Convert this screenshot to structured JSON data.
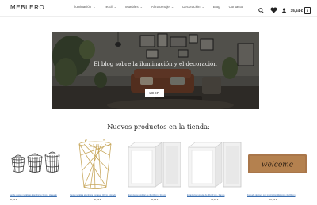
{
  "header": {
    "logo": "MEBLERO",
    "nav": [
      {
        "label": "Iluminación",
        "has_dropdown": true
      },
      {
        "label": "Textil",
        "has_dropdown": true
      },
      {
        "label": "Muebles",
        "has_dropdown": true
      },
      {
        "label": "Almacenaje",
        "has_dropdown": true
      },
      {
        "label": "Decoración",
        "has_dropdown": true
      },
      {
        "label": "Blog",
        "has_dropdown": false
      },
      {
        "label": "Contacto",
        "has_dropdown": false
      }
    ],
    "icons": [
      "search-icon",
      "heart-icon",
      "user-icon"
    ],
    "cart_total": "35,54 €",
    "cart_count": "3"
  },
  "hero": {
    "title": "El blog sobre la iluminación y el decoración",
    "button_label": "LEER"
  },
  "products_section": {
    "title": "Nuevos productos en la tienda:",
    "items": [
      {
        "name": "Set de cestas metálicas alámbricas 3 pcs - plateado",
        "price": "42,99 €",
        "image": "wire-baskets"
      },
      {
        "name": "Cesta metálica alámbrica con asas 40 cm - dorado",
        "price": "38,99 €",
        "image": "gold-wire-basket"
      },
      {
        "name": "Estantería modular de 40x40 cm - blanco",
        "price": "44,99 €",
        "image": "white-cube-shelf"
      },
      {
        "name": "Estantería modular de 40x40 cm - blanco",
        "price": "44,99 €",
        "image": "white-cube-shelf"
      },
      {
        "name": "Felpudo de coco con inscripción Welcome 40x60 cm",
        "price": "16,99 €",
        "image": "welcome-doormat",
        "mat_text": "welcome"
      }
    ]
  }
}
